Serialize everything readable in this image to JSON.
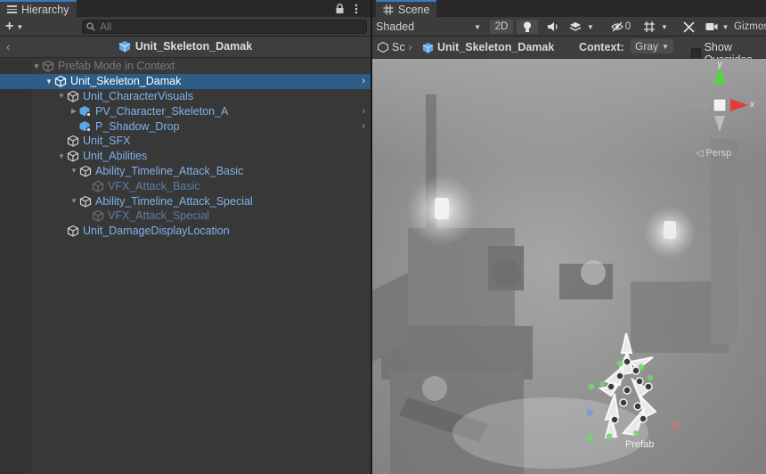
{
  "hierarchy": {
    "tab_label": "Hierarchy",
    "search_placeholder": "All",
    "breadcrumb_title": "Unit_Skeleton_Damak",
    "context_label": "Prefab Mode in Context",
    "items": [
      {
        "label": "Unit_Skeleton_Damak"
      },
      {
        "label": "Unit_CharacterVisuals"
      },
      {
        "label": "PV_Character_Skeleton_A"
      },
      {
        "label": "P_Shadow_Drop"
      },
      {
        "label": "Unit_SFX"
      },
      {
        "label": "Unit_Abilities"
      },
      {
        "label": "Ability_Timeline_Attack_Basic"
      },
      {
        "label": "VFX_Attack_Basic"
      },
      {
        "label": "Ability_Timeline_Attack_Special"
      },
      {
        "label": "VFX_Attack_Special"
      },
      {
        "label": "Unit_DamageDisplayLocation"
      }
    ]
  },
  "scene": {
    "tab_label": "Scene",
    "shading_mode": "Shaded",
    "mode_2d": "2D",
    "hidden_count": "0",
    "gizmos_label": "Gizmos",
    "breadcrumb_short": "Sc",
    "breadcrumb_title": "Unit_Skeleton_Damak",
    "context_label": "Context:",
    "context_value": "Gray",
    "show_overrides": "Show Overrides",
    "gizmo_axis_y": "y",
    "gizmo_axis_x": "x",
    "gizmo_persp": "Persp",
    "prefab_label": "Prefab"
  },
  "colors": {
    "selection": "#2c5d87",
    "prefab_blue": "#7fb2ea",
    "axis_x": "#e23b3b",
    "axis_y": "#5dd04a",
    "tab_accent": "#3a79bb"
  }
}
